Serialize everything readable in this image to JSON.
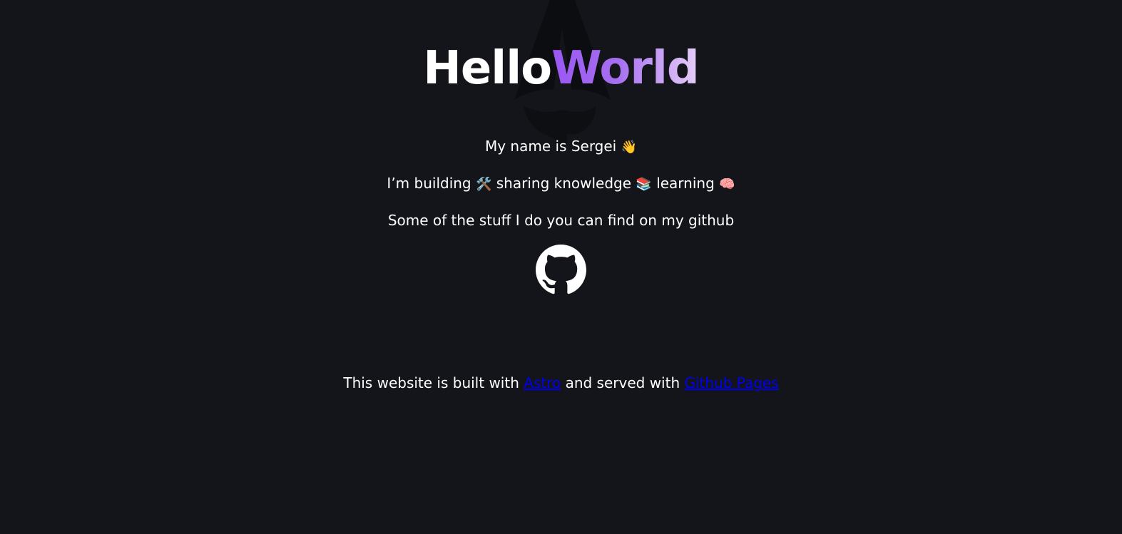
{
  "header": {
    "title_part1": "Hello",
    "title_part2": "World"
  },
  "intro": {
    "name_line": "My name is Sergei",
    "wave_emoji": "👋",
    "building_prefix": "I’m building",
    "tools_emoji": "🛠️",
    "sharing_text": "sharing knowledge",
    "books_emoji": "📚",
    "learning_text": "learning",
    "brain_emoji": "🧠",
    "github_line": "Some of the stuff I do you can find on my github"
  },
  "footer": {
    "prefix": "This website is built with",
    "astro_link": "Astro",
    "middle": "and served with",
    "pages_link": "Github Pages"
  },
  "colors": {
    "background": "#13151a",
    "gradient_start": "#9a57f2",
    "gradient_end": "#e6cff7",
    "link": "#0000ee"
  },
  "icons": {
    "background": "astro-logo-icon",
    "github": "github-icon"
  }
}
